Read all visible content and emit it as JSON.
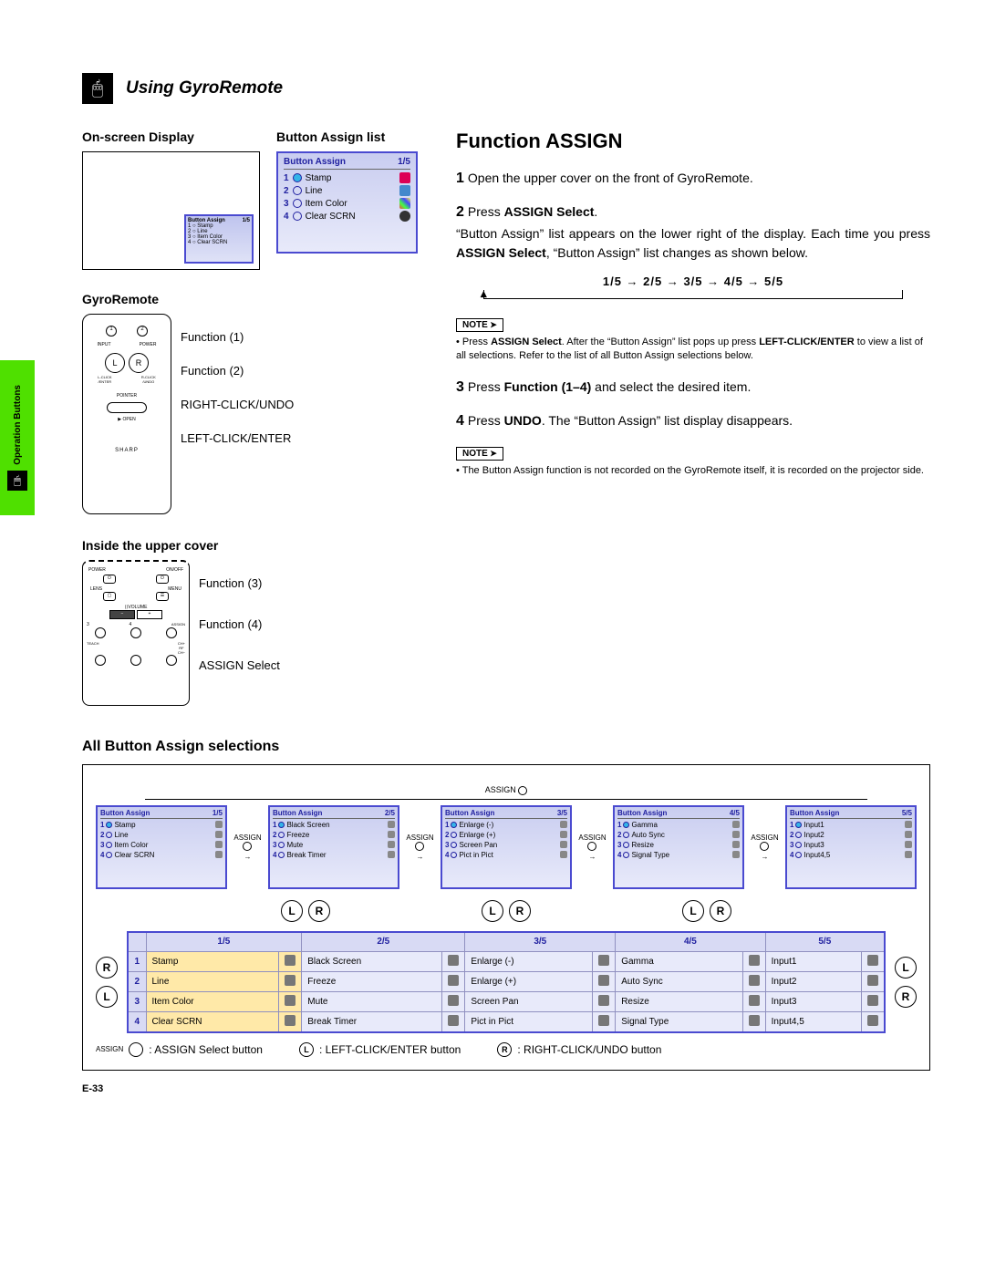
{
  "side_tab": {
    "label": "Operation Buttons"
  },
  "header": {
    "title": "Using GyroRemote"
  },
  "left": {
    "osd_heading": "On-screen Display",
    "ba_list_heading": "Button Assign list",
    "ba_list": {
      "title": "Button Assign",
      "page": "1/5",
      "rows": [
        {
          "n": "1",
          "label": "Stamp"
        },
        {
          "n": "2",
          "label": "Line"
        },
        {
          "n": "3",
          "label": "Item Color"
        },
        {
          "n": "4",
          "label": "Clear SCRN"
        }
      ]
    },
    "gyro_heading": "GyroRemote",
    "gyro_labels": {
      "f1": "Function (1)",
      "f2": "Function (2)",
      "rc": "RIGHT-CLICK/UNDO",
      "lc": "LEFT-CLICK/ENTER"
    },
    "cover_heading": "Inside the upper cover",
    "cover_labels": {
      "f3": "Function (3)",
      "f4": "Function (4)",
      "as": "ASSIGN Select"
    }
  },
  "right": {
    "title": "Function ASSIGN",
    "step1": {
      "n": "1",
      "text": "Open the upper cover on the front of GyroRemote."
    },
    "step2": {
      "n": "2",
      "lead": "Press ",
      "bold": "ASSIGN Select",
      "tail": ".",
      "body": "“Button Assign” list appears on the lower right of the display. Each time you press ASSIGN Select, “Button Assign” list changes as shown below."
    },
    "sequence": "1/5 → 2/5 → 3/5 → 4/5 → 5/5",
    "note1_tag": "NOTE",
    "note1_body": "Press ASSIGN Select. After the “Button Assign” list pops up press LEFT-CLICK/ENTER to view a list of all selections. Refer to the list of all Button Assign selections below.",
    "step3": {
      "n": "3",
      "lead": "Press ",
      "bold": "Function (1–4)",
      "tail": " and select the desired item."
    },
    "step4": {
      "n": "4",
      "lead": "Press ",
      "bold": "UNDO",
      "tail": ". The “Button Assign” list display disappears."
    },
    "note2_tag": "NOTE",
    "note2_body": "The Button Assign function is not recorded on the GyroRemote itself, it is recorded on the projector side."
  },
  "all_sel": {
    "heading": "All Button Assign selections",
    "assign_label": "ASSIGN",
    "pages": [
      {
        "page": "1/5",
        "rows": [
          "Stamp",
          "Line",
          "Item Color",
          "Clear SCRN"
        ]
      },
      {
        "page": "2/5",
        "rows": [
          "Black Screen",
          "Freeze",
          "Mute",
          "Break Timer"
        ]
      },
      {
        "page": "3/5",
        "rows": [
          "Enlarge (-)",
          "Enlarge (+)",
          "Screen Pan",
          "Pict in Pict"
        ]
      },
      {
        "page": "4/5",
        "rows": [
          "Gamma",
          "Auto Sync",
          "Resize",
          "Signal Type"
        ]
      },
      {
        "page": "5/5",
        "rows": [
          "Input1",
          "Input2",
          "Input3",
          "Input4,5"
        ]
      }
    ],
    "table_rows": [
      {
        "n": "1",
        "c": [
          "Stamp",
          "Black Screen",
          "Enlarge (-)",
          "Gamma",
          "Input1"
        ]
      },
      {
        "n": "2",
        "c": [
          "Line",
          "Freeze",
          "Enlarge (+)",
          "Auto Sync",
          "Input2"
        ]
      },
      {
        "n": "3",
        "c": [
          "Item Color",
          "Mute",
          "Screen Pan",
          "Resize",
          "Input3"
        ]
      },
      {
        "n": "4",
        "c": [
          "Clear SCRN",
          "Break Timer",
          "Pict in Pict",
          "Signal Type",
          "Input4,5"
        ]
      }
    ],
    "legend": {
      "assign": ": ASSIGN Select button",
      "l": ": LEFT-CLICK/ENTER button",
      "r": ": RIGHT-CLICK/UNDO button",
      "L": "L",
      "R": "R"
    }
  },
  "page_num": "E-33"
}
